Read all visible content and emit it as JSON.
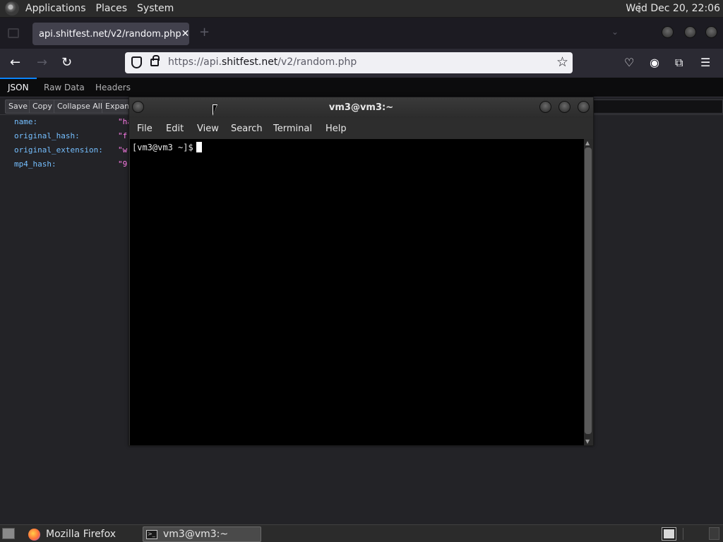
{
  "panel": {
    "menus": [
      "Applications",
      "Places",
      "System"
    ],
    "clock": "Wed Dec 20, 22:06"
  },
  "browser": {
    "tab_title": "api.shitfest.net/v2/random.php",
    "tab_close": "✕",
    "new_tab": "+",
    "url_scheme": "https://api.",
    "url_domain": "shitfest.net",
    "url_path": "/v2/random.php",
    "json_tabs": [
      "JSON",
      "Raw Data",
      "Headers"
    ],
    "json_toolbar": [
      "Save",
      "Copy",
      "Collapse All",
      "Expand"
    ],
    "json_rows": [
      {
        "key": "name:",
        "value": "\"ha"
      },
      {
        "key": "original_hash:",
        "value": "\"f"
      },
      {
        "key": "original_extension:",
        "value": "\"w"
      },
      {
        "key": "mp4_hash:",
        "value": "\"9"
      }
    ]
  },
  "terminal": {
    "title": "vm3@vm3:~",
    "menus": [
      "File",
      "Edit",
      "View",
      "Search",
      "Terminal",
      "Help"
    ],
    "prompt": "[vm3@vm3 ~]$"
  },
  "taskbar": {
    "tasks": [
      "Mozilla Firefox",
      "vm3@vm3:~"
    ]
  }
}
